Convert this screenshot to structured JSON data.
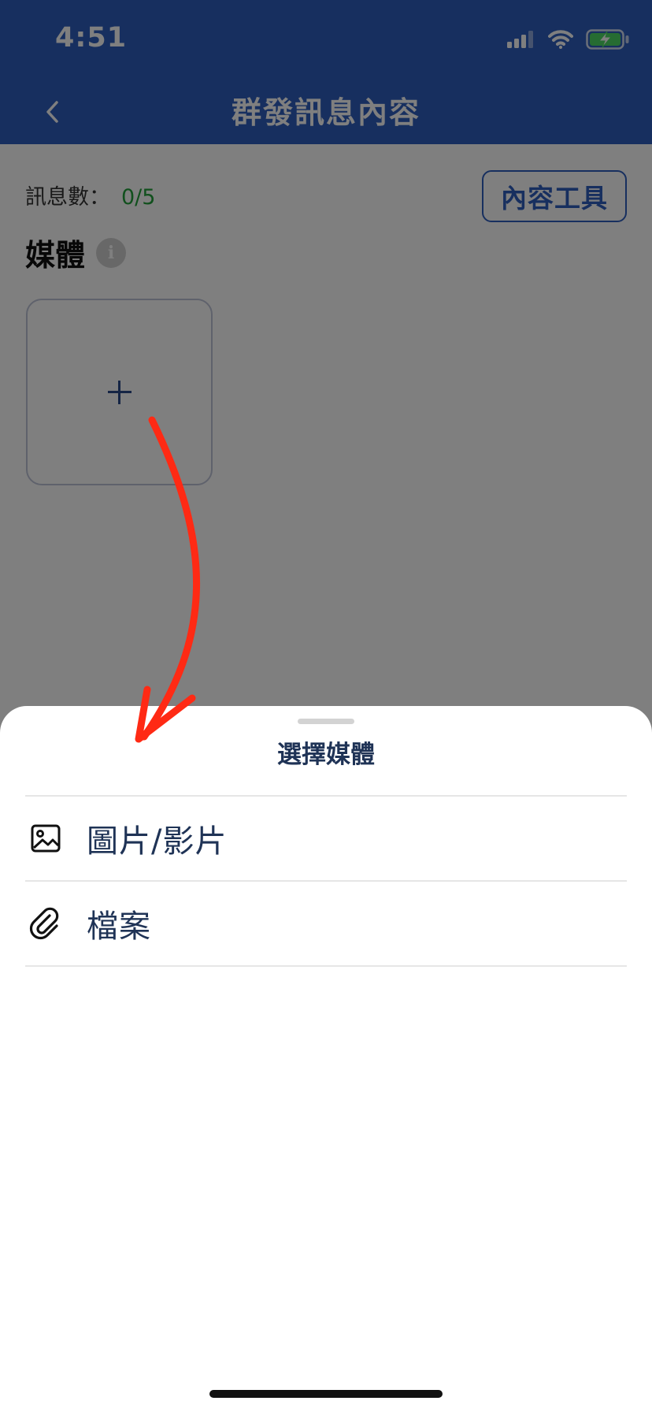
{
  "status_bar": {
    "time": "4:51"
  },
  "nav": {
    "title": "群發訊息內容",
    "back_icon": "chevron-left-icon"
  },
  "content": {
    "message_count_label": "訊息數：",
    "message_count_value": "0/5",
    "content_tools_label": "內容工具",
    "media_title": "媒體",
    "info_icon_glyph": "i",
    "add_media_icon": "plus-icon"
  },
  "sheet": {
    "title": "選擇媒體",
    "options": [
      {
        "label": "圖片/影片",
        "icon": "image-icon"
      },
      {
        "label": "檔案",
        "icon": "paperclip-icon"
      }
    ]
  },
  "colors": {
    "header": "#2f5fbf",
    "accent_green": "#22a13b",
    "annotation_arrow": "#ff2a14",
    "text_dark_blue": "#1f3356"
  }
}
